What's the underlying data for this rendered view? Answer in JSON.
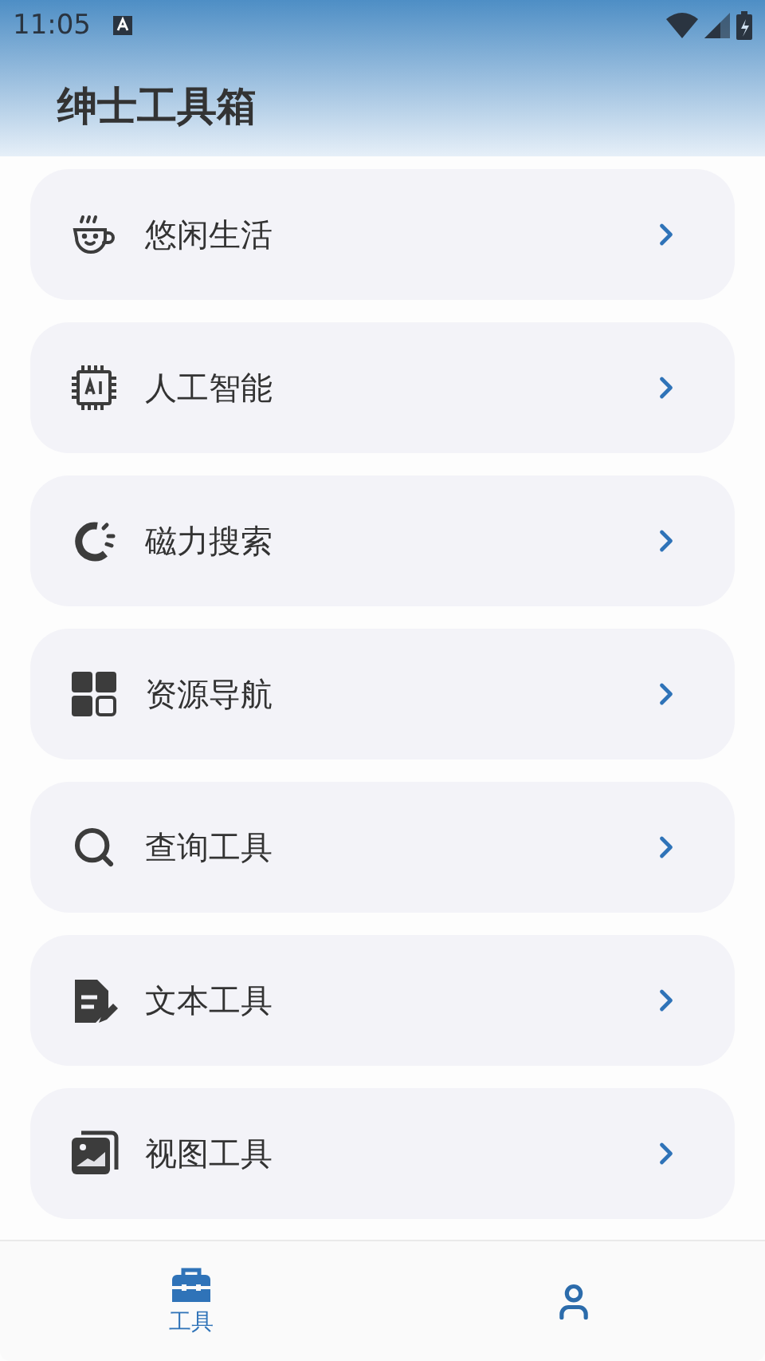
{
  "status_bar": {
    "time": "11:05"
  },
  "header": {
    "title": "绅士工具箱"
  },
  "items": [
    {
      "label": "悠闲生活"
    },
    {
      "label": "人工智能"
    },
    {
      "label": "磁力搜索"
    },
    {
      "label": "资源导航"
    },
    {
      "label": "查询工具"
    },
    {
      "label": "文本工具"
    },
    {
      "label": "视图工具"
    }
  ],
  "bottom_nav": [
    {
      "label": "工具",
      "selected": true
    },
    {
      "selected": false
    }
  ]
}
